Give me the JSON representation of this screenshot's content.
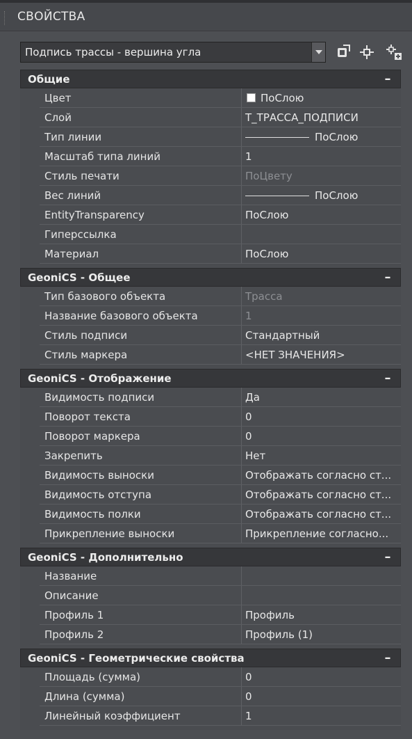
{
  "panel": {
    "title": "СВОЙСТВА"
  },
  "selector": {
    "value": "Подпись трассы - вершина угла"
  },
  "toolbar": {
    "icons": [
      "quick-select-icon",
      "select-objects-icon",
      "toggle-pickadd-icon"
    ]
  },
  "sections": [
    {
      "title": "Общие",
      "toggle": "–",
      "rows": [
        {
          "name": "Цвет",
          "value": "ПоСлою"
        },
        {
          "name": "Слой",
          "value": "Т_ТРАССА_ПОДПИСИ"
        },
        {
          "name": "Тип линии",
          "value": "ПоСлою"
        },
        {
          "name": "Масштаб типа линий",
          "value": "1"
        },
        {
          "name": "Стиль печати",
          "value": "ПоЦвету"
        },
        {
          "name": "Вес линий",
          "value": "ПоСлою"
        },
        {
          "name": "EntityTransparency",
          "value": "ПоСлою"
        },
        {
          "name": "Гиперссылка",
          "value": ""
        },
        {
          "name": "Материал",
          "value": "ПоСлою"
        }
      ]
    },
    {
      "title": "GeoniCS - Общее",
      "toggle": "–",
      "rows": [
        {
          "name": "Тип базового объекта",
          "value": "Трасса"
        },
        {
          "name": "Название базового объекта",
          "value": "1"
        },
        {
          "name": "Стиль подписи",
          "value": "Стандартный"
        },
        {
          "name": "Стиль маркера",
          "value": "<НЕТ ЗНАЧЕНИЯ>"
        }
      ]
    },
    {
      "title": "GeoniCS - Отображение",
      "toggle": "–",
      "rows": [
        {
          "name": "Видимость подписи",
          "value": "Да"
        },
        {
          "name": "Поворот текста",
          "value": "0"
        },
        {
          "name": "Поворот маркера",
          "value": "0"
        },
        {
          "name": "Закрепить",
          "value": "Нет"
        },
        {
          "name": "Видимость выноски",
          "value": "Отображать согласно ст..."
        },
        {
          "name": "Видимость отступа",
          "value": "Отображать согласно ст..."
        },
        {
          "name": "Видимость полки",
          "value": "Отображать согласно ст..."
        },
        {
          "name": "Прикрепление выноски",
          "value": "Прикрепление согласно..."
        }
      ]
    },
    {
      "title": "GeoniCS - Дополнительно",
      "toggle": "–",
      "rows": [
        {
          "name": "Название",
          "value": ""
        },
        {
          "name": "Описание",
          "value": ""
        },
        {
          "name": "Профиль 1",
          "value": "Профиль"
        },
        {
          "name": "Профиль 2",
          "value": "Профиль (1)"
        }
      ]
    },
    {
      "title": "GeoniCS - Геометрические свойства",
      "toggle": "–",
      "rows": [
        {
          "name": "Площадь (сумма)",
          "value": "0"
        },
        {
          "name": "Длина (сумма)",
          "value": "0"
        },
        {
          "name": "Линейный коэффициент",
          "value": "1"
        }
      ]
    }
  ]
}
